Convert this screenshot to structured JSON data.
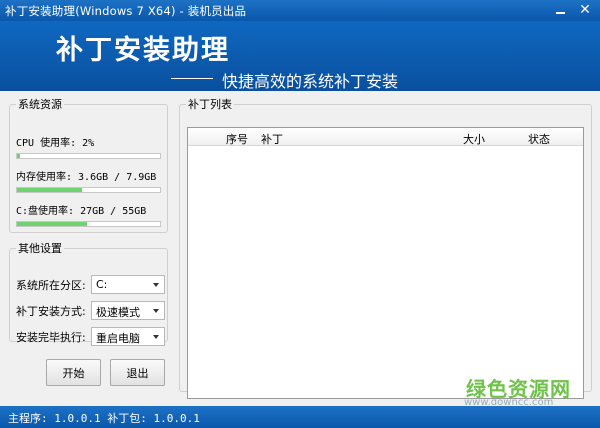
{
  "window": {
    "title": "补丁安装助理(Windows 7 X64) - 装机员出品"
  },
  "banner": {
    "brand": "补丁安装助理",
    "slogan": "快捷高效的系统补丁安装"
  },
  "system_resources": {
    "legend": "系统资源",
    "cpu": {
      "label": "CPU 使用率: 2%",
      "usage": 0.02
    },
    "memory": {
      "label": "内存使用率: 3.6GB / 7.9GB",
      "usage": 0.456
    },
    "disk": {
      "label": "C:盘使用率: 27GB / 55GB",
      "usage": 0.491
    }
  },
  "other_settings": {
    "legend": "其他设置",
    "partition": {
      "label": "系统所在分区:",
      "value": "C:"
    },
    "install_mode": {
      "label": "补丁安装方式:",
      "value": "极速模式"
    },
    "after_install": {
      "label": "安装完毕执行:",
      "value": "重启电脑"
    }
  },
  "buttons": {
    "start": "开始",
    "exit": "退出"
  },
  "patch_list": {
    "legend": "补丁列表",
    "columns": [
      "序号",
      "补丁",
      "大小",
      "状态"
    ],
    "rows": []
  },
  "statusbar": {
    "text": "主程序: 1.0.0.1 补丁包: 1.0.0.1"
  },
  "watermark": {
    "name": "绿色资源网",
    "url": "www.downcc.com"
  },
  "colors": {
    "title_bar": "#0a57ab",
    "banner": "#0e68c0",
    "progress": "#6fd36f"
  }
}
